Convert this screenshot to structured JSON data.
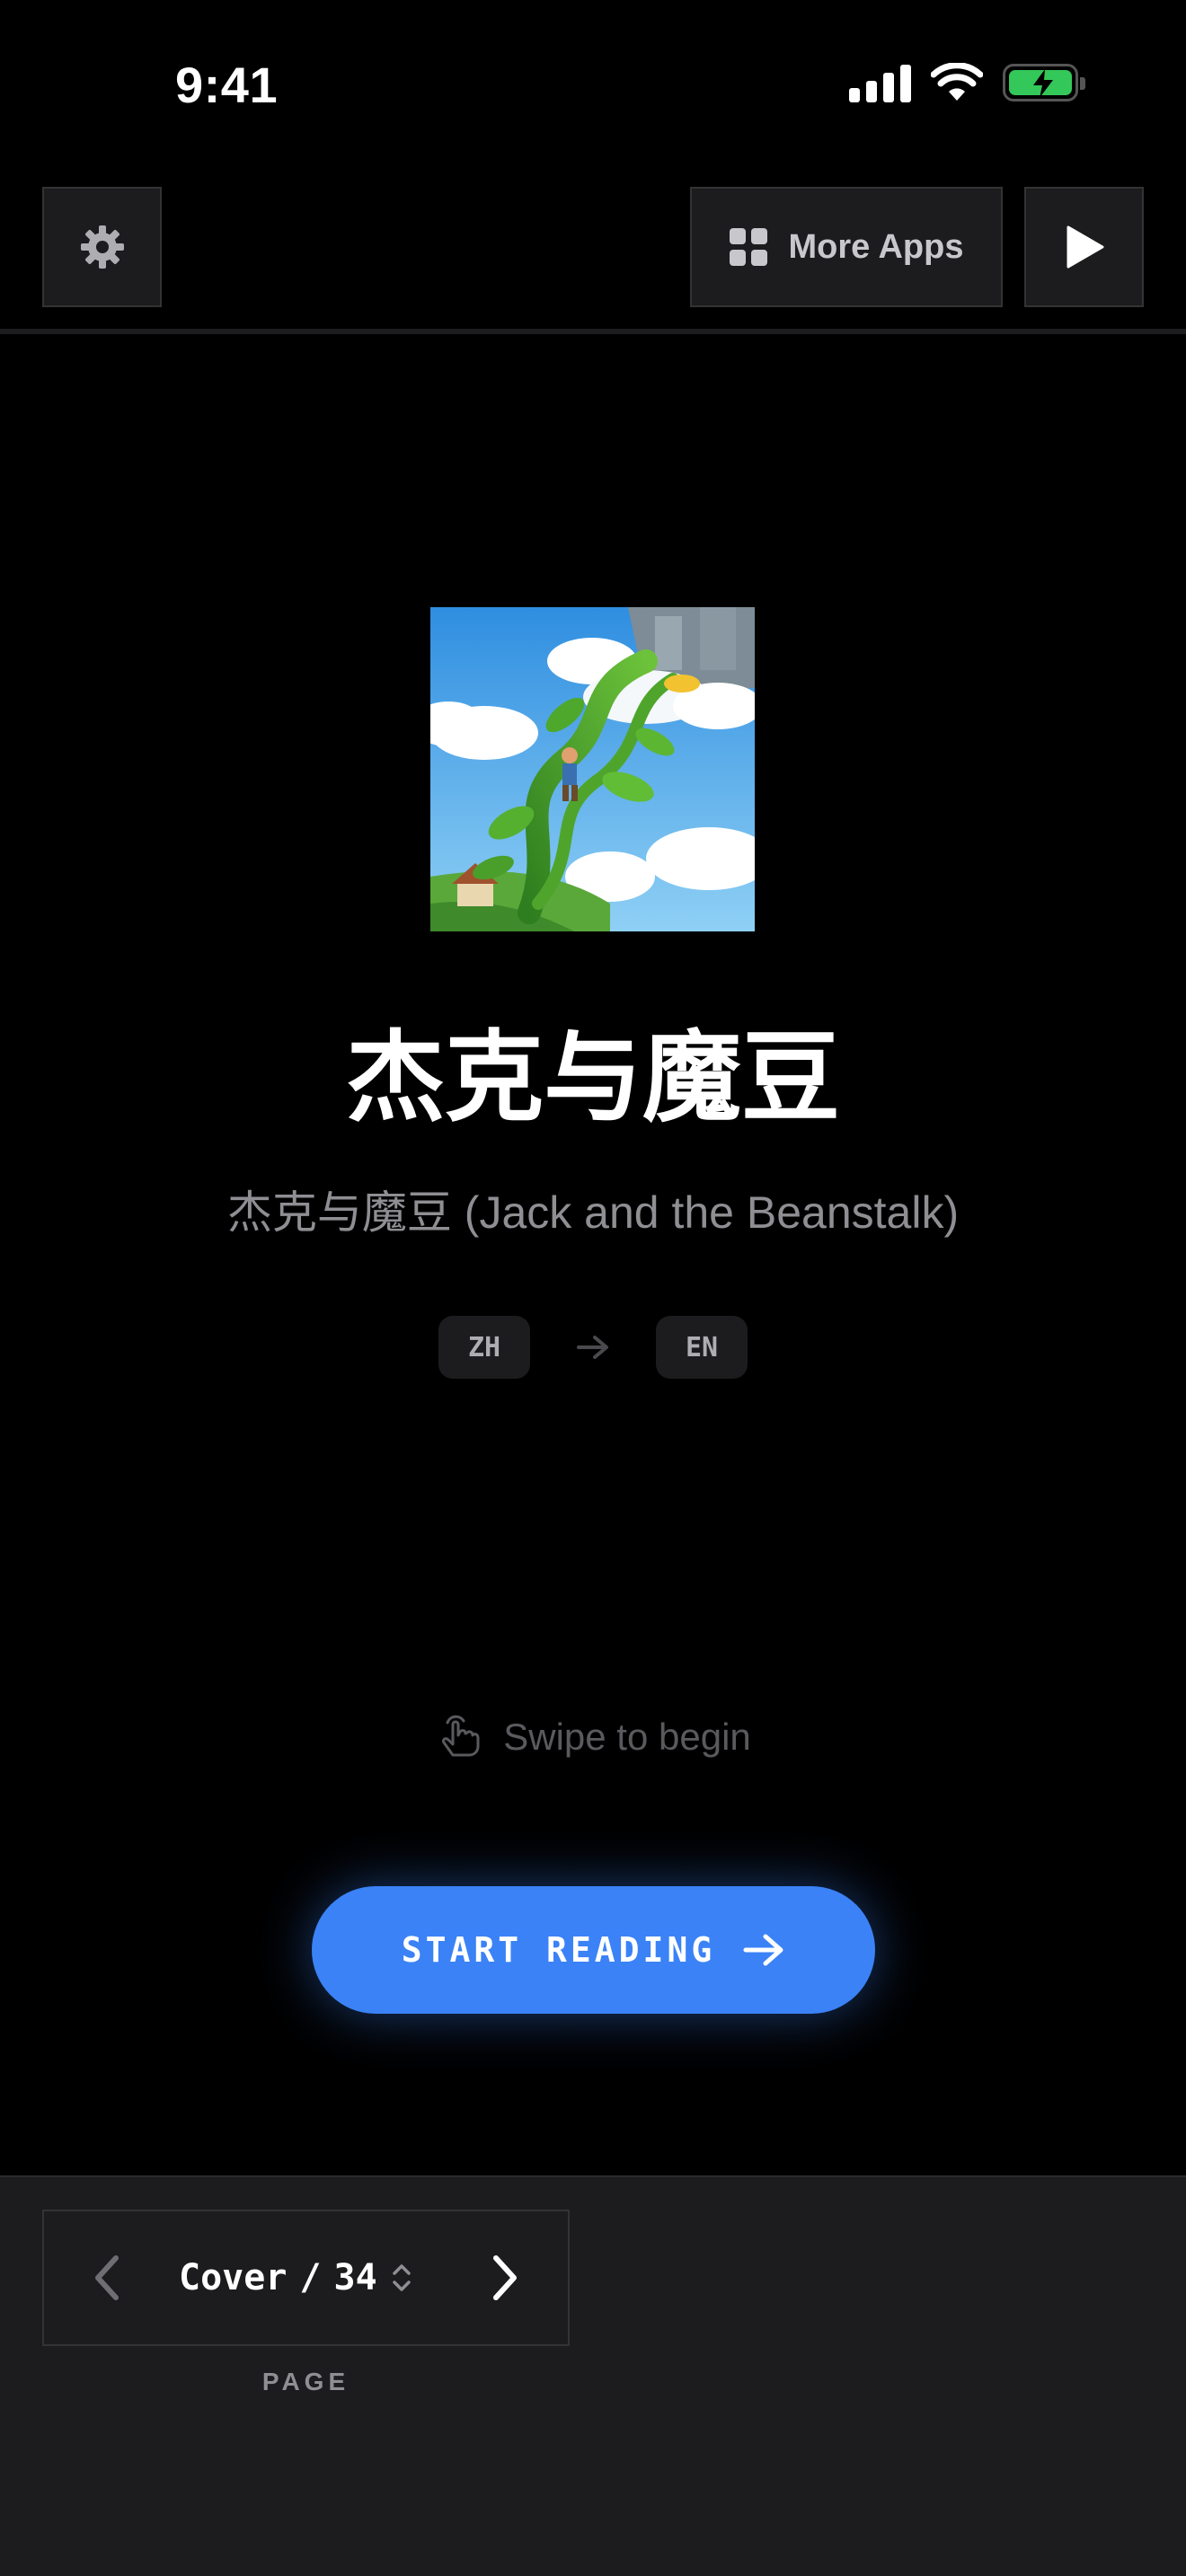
{
  "status_bar": {
    "time": "9:41"
  },
  "toolbar": {
    "more_apps_label": "More Apps"
  },
  "book": {
    "title": "杰克与魔豆",
    "subtitle": "杰克与魔豆 (Jack and the Beanstalk)",
    "source_lang": "ZH",
    "target_lang": "EN"
  },
  "swipe_hint": "Swipe to begin",
  "start_button": {
    "label": "START READING"
  },
  "pager": {
    "current": "Cover",
    "separator": "/",
    "total": "34",
    "label": "PAGE"
  },
  "colors": {
    "accent": "#3b82f6",
    "battery": "#34c759",
    "panel": "#1c1c1e"
  }
}
